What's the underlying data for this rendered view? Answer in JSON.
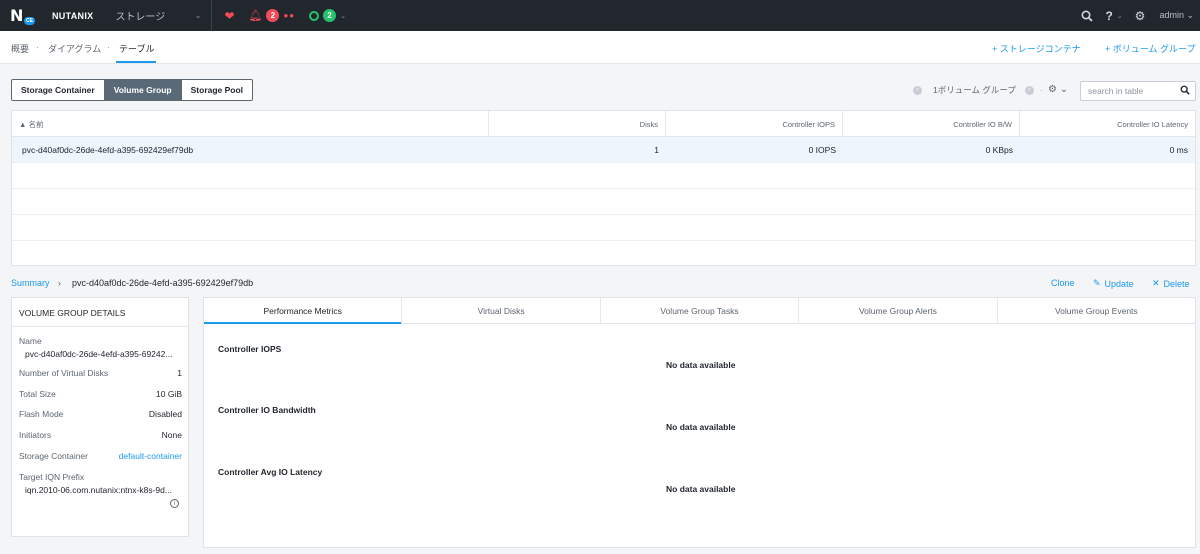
{
  "topbar": {
    "logo_letter": "N",
    "logo_badge": "CE",
    "brand": "NUTANIX",
    "context_menu": "ストレージ",
    "alert_count": "2",
    "task_count": "2",
    "user": "admin"
  },
  "subnav": {
    "crumbs": [
      "概要",
      "ダイアグラム",
      "テーブル"
    ],
    "actions": [
      "+ ストレージコンテナ",
      "+ ボリューム グループ"
    ]
  },
  "entity_toggle": {
    "options": [
      "Storage Container",
      "Volume Group",
      "Storage Pool"
    ],
    "selected": "Volume Group"
  },
  "toolbar": {
    "pager_text": "1ボリューム グループ",
    "search_placeholder": "search in table"
  },
  "table": {
    "columns": [
      "▲ 名前",
      "Disks",
      "Controller IOPS",
      "Controller IO B/W",
      "Controller IO Latency"
    ],
    "rows": [
      [
        "pvc-d40af0dc-26de-4efd-a395-692429ef79db",
        "1",
        "0 IOPS",
        "0 KBps",
        "0 ms"
      ]
    ]
  },
  "detail_breadcrumb": {
    "summary": "Summary",
    "arrow": "›",
    "name": "pvc-d40af0dc-26de-4efd-a395-692429ef79db",
    "actions": [
      "Clone",
      "Update",
      "Delete"
    ]
  },
  "vg_details": {
    "title": "VOLUME GROUP DETAILS",
    "name_label": "Name",
    "name_value": "pvc-d40af0dc-26de-4efd-a395-69242...",
    "fields": [
      {
        "label": "Number of Virtual Disks",
        "value": "1"
      },
      {
        "label": "Total Size",
        "value": "10 GiB"
      },
      {
        "label": "Flash Mode",
        "value": "Disabled"
      },
      {
        "label": "Initiators",
        "value": "None"
      },
      {
        "label": "Storage Container",
        "value": "default-container"
      }
    ],
    "iqn_label": "Target IQN Prefix",
    "iqn_value": "iqn.2010-06.com.nutanix:ntnx-k8s-9d..."
  },
  "metrics": {
    "tabs": [
      "Performance Metrics",
      "Virtual Disks",
      "Volume Group Tasks",
      "Volume Group Alerts",
      "Volume Group Events"
    ],
    "active_tab": "Performance Metrics",
    "sections": [
      {
        "title": "Controller IOPS",
        "empty": "No data available"
      },
      {
        "title": "Controller IO Bandwidth",
        "empty": "No data available"
      },
      {
        "title": "Controller Avg IO Latency",
        "empty": "No data available"
      }
    ]
  },
  "colors": {
    "topbar_bg": "#22272e",
    "accent": "#1b9aee",
    "alert_red": "#f44b58",
    "ok_green": "#24c26a",
    "toggle_selected": "#5a6977"
  }
}
